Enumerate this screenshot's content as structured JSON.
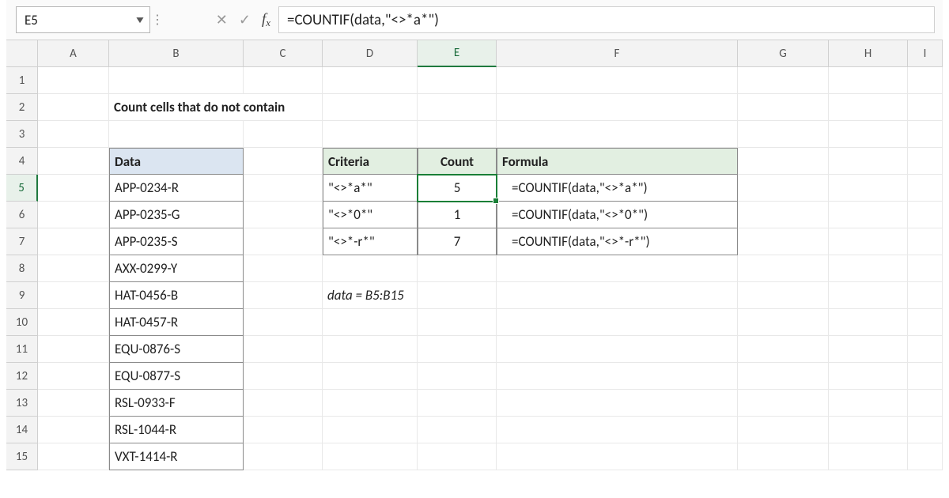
{
  "formula_bar": {
    "cell_ref": "E5",
    "formula": "=COUNTIF(data,\"<>*a*\")"
  },
  "columns": [
    "A",
    "B",
    "C",
    "D",
    "E",
    "F",
    "G",
    "H",
    "I"
  ],
  "rows": [
    "1",
    "2",
    "3",
    "4",
    "5",
    "6",
    "7",
    "8",
    "9",
    "10",
    "11",
    "12",
    "13",
    "14",
    "15"
  ],
  "active": {
    "col": "E",
    "row": "5"
  },
  "title": "Count cells that do not contain",
  "data_header": "Data",
  "data_values": [
    "APP-0234-R",
    "APP-0235-G",
    "APP-0235-S",
    "AXX-0299-Y",
    "HAT-0456-B",
    "HAT-0457-R",
    "EQU-0876-S",
    "EQU-0877-S",
    "RSL-0933-F",
    "RSL-1044-R",
    "VXT-1414-R"
  ],
  "table": {
    "headers": {
      "criteria": "Criteria",
      "count": "Count",
      "formula": "Formula"
    },
    "rows": [
      {
        "criteria": "\"<>*a*\"",
        "count": "5",
        "formula": "=COUNTIF(data,\"<>*a*\")"
      },
      {
        "criteria": "\"<>*0*\"",
        "count": "1",
        "formula": "=COUNTIF(data,\"<>*0*\")"
      },
      {
        "criteria": "\"<>*-r*\"",
        "count": "7",
        "formula": "=COUNTIF(data,\"<>*-r*\")"
      }
    ]
  },
  "note": "data = B5:B15"
}
